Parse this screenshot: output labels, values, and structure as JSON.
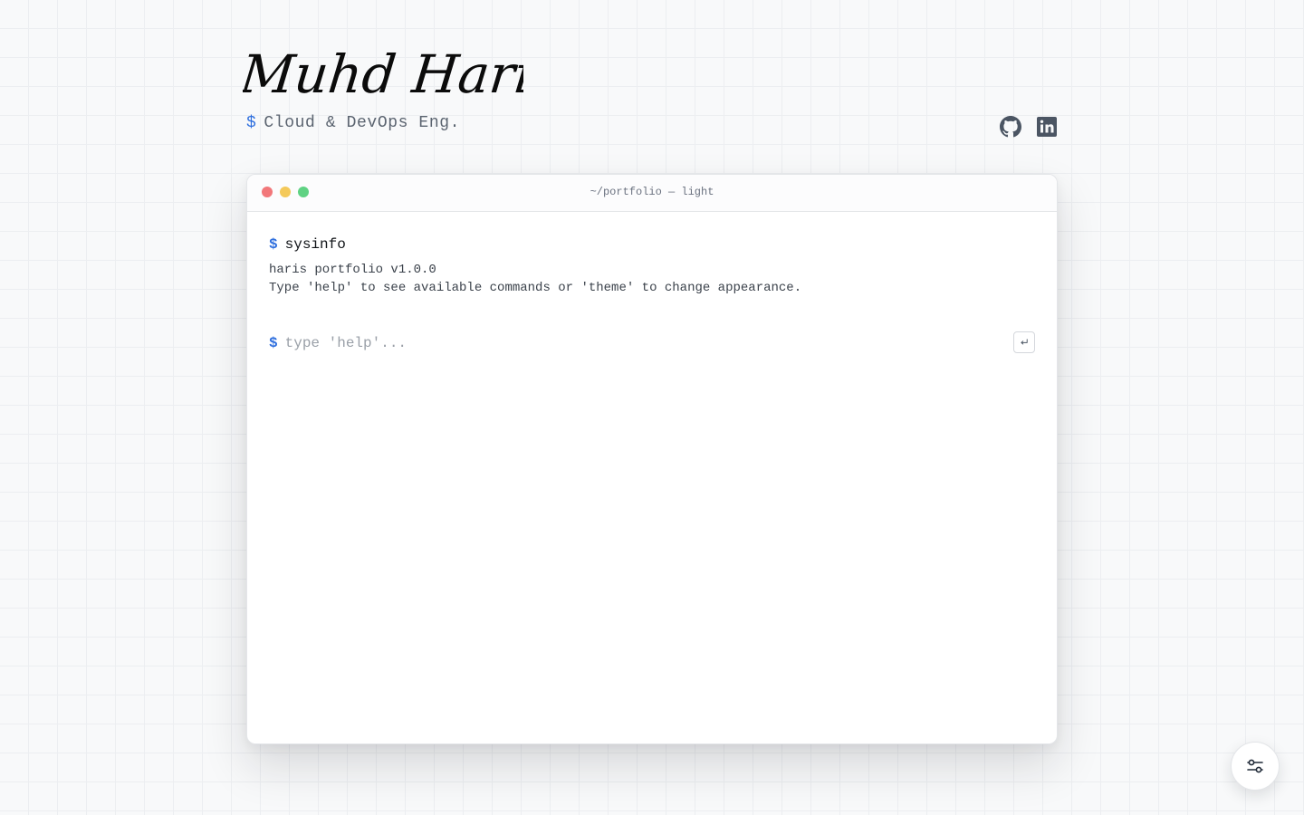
{
  "header": {
    "name": "Muhd Haris",
    "tagline_prompt": "$",
    "tagline": "Cloud & DevOps Eng.",
    "socials": [
      {
        "icon": "github-icon"
      },
      {
        "icon": "linkedin-icon"
      }
    ]
  },
  "terminal": {
    "window_title": "~/portfolio — light",
    "traffic_lights": {
      "close_color": "#f2777a",
      "minimize_color": "#f4c95a",
      "maximize_color": "#5fd283"
    },
    "history": [
      {
        "prompt": "$",
        "command": "sysinfo",
        "output": [
          "haris portfolio v1.0.0",
          "Type 'help' to see available commands or 'theme' to change appearance."
        ]
      }
    ],
    "input": {
      "prompt": "$",
      "value": "",
      "placeholder": "type 'help'..."
    },
    "submit_icon": "enter-icon"
  },
  "settings_button": {
    "icon": "sliders-icon"
  },
  "colors": {
    "accent": "#2f6fde",
    "background": "#f8f9fa",
    "grid": "#eceef1",
    "terminal_bg": "#ffffff"
  }
}
